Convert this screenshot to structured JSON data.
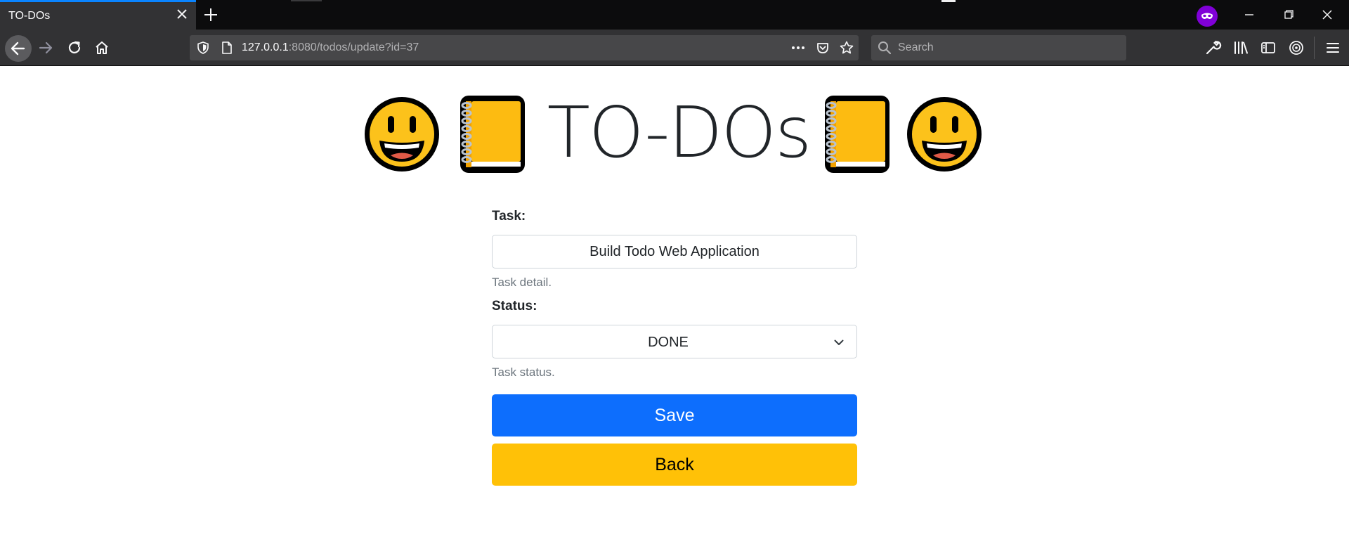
{
  "browser": {
    "tab_title": "TO-DOs",
    "url_host": "127.0.0.1",
    "url_rest": ":8080/todos/update?id=37",
    "search_placeholder": "Search"
  },
  "page": {
    "title": "TO-DOs",
    "emoji_left": [
      "grinning-face-icon",
      "notebook-icon"
    ],
    "emoji_right": [
      "notebook-icon",
      "grinning-face-icon"
    ]
  },
  "form": {
    "task_label": "Task:",
    "task_value": "Build Todo Web Application",
    "task_help": "Task detail.",
    "status_label": "Status:",
    "status_value": "DONE",
    "status_help": "Task status.",
    "save_label": "Save",
    "back_label": "Back"
  },
  "colors": {
    "primary": "#0d6efd",
    "warning": "#ffc107",
    "tab_accent": "#0a84ff",
    "private_badge": "#8000d7"
  }
}
